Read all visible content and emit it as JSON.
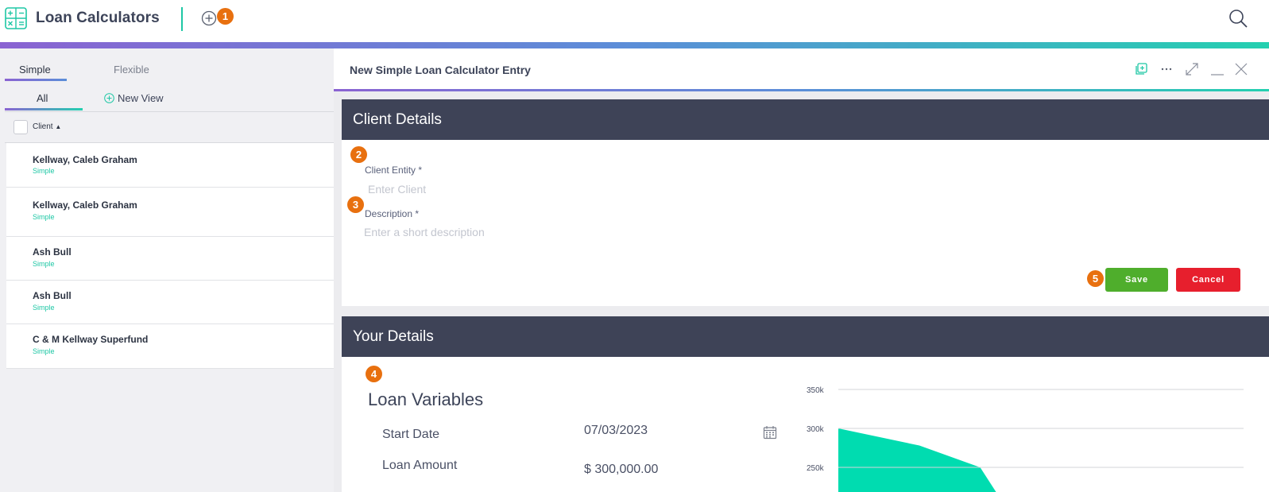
{
  "app": {
    "title": "Loan Calculators",
    "logo_icon": "calculator-grid-icon",
    "accent_color": "#1ec7a5"
  },
  "markers": [
    "1",
    "2",
    "3",
    "4",
    "5"
  ],
  "left": {
    "tabs": [
      {
        "label": "Simple",
        "active": true
      },
      {
        "label": "Flexible",
        "active": false
      }
    ],
    "views": {
      "all_label": "All",
      "new_view_label": "New View"
    },
    "column_header": "Client",
    "rows": [
      {
        "name": "Kellway, Caleb Graham",
        "type": "Simple"
      },
      {
        "name": "Kellway, Caleb Graham",
        "type": "Simple"
      },
      {
        "name": "Ash Bull",
        "type": "Simple"
      },
      {
        "name": "Ash Bull",
        "type": "Simple"
      },
      {
        "name": "C & M Kellway Superfund",
        "type": "Simple"
      }
    ]
  },
  "form": {
    "title": "New Simple Loan Calculator Entry",
    "client_section": {
      "title": "Client Details",
      "client_entity_label": "Client Entity *",
      "client_entity_placeholder": "Enter Client",
      "description_label": "Description *",
      "description_placeholder": "Enter a short description",
      "save_label": "Save",
      "cancel_label": "Cancel",
      "save_color": "#4fae2c",
      "cancel_color": "#e71f2d"
    },
    "your_section": {
      "title": "Your Details",
      "loan_variables_title": "Loan Variables",
      "start_date_label": "Start Date",
      "start_date_value": "07/03/2023",
      "loan_amount_label": "Loan Amount",
      "loan_amount_value": "$ 300,000.00"
    }
  },
  "chart_data": {
    "type": "area",
    "ytick_labels": [
      "350k",
      "300k",
      "250k"
    ],
    "yticks": [
      350000,
      300000,
      250000
    ],
    "x": [
      0,
      0.2,
      0.35
    ],
    "values": [
      300000,
      278000,
      250000
    ],
    "fill_color": "#00dcb0",
    "grid": true
  }
}
